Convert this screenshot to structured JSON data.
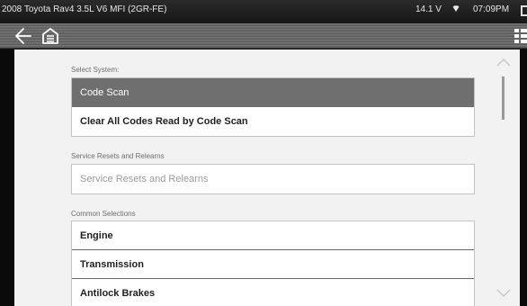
{
  "status": {
    "vehicle": "2008 Toyota Rav4 3.5L V6 MFI (2GR-FE)",
    "voltage": "14.1 V",
    "time": "07:09PM"
  },
  "icons": {
    "back": "back-arrow-icon",
    "home": "home-icon",
    "menu": "menu-grid-icon",
    "wifi": "wifi-icon",
    "battery": "battery-icon"
  },
  "colors": {
    "selected_row": "#6f6f6f",
    "content_bg": "#f2f2f2",
    "toolbar": "#686868"
  },
  "sections": [
    {
      "label": "Select System:",
      "items": [
        {
          "label": "Code Scan",
          "selected": true
        },
        {
          "label": "Clear All Codes Read by Code Scan"
        }
      ]
    },
    {
      "label": "Service Resets and Relearns",
      "items": [
        {
          "label": "Service Resets and Relearns",
          "disabled": true
        }
      ]
    },
    {
      "label": "Common Selections",
      "items": [
        {
          "label": "Engine"
        },
        {
          "label": "Transmission"
        },
        {
          "label": "Antilock Brakes"
        }
      ]
    }
  ]
}
